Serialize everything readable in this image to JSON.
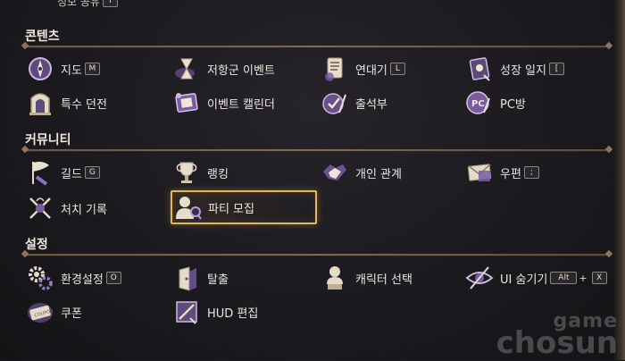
{
  "top_partial": {
    "label": "정보 공유",
    "key": "I"
  },
  "sections": {
    "content": {
      "title": "콘텐츠",
      "items": [
        {
          "icon": "compass-icon",
          "label": "지도",
          "key": "M"
        },
        {
          "icon": "hourglass-icon",
          "label": "저항군 이벤트"
        },
        {
          "icon": "scroll-icon",
          "label": "연대기",
          "key": "L"
        },
        {
          "icon": "journal-icon",
          "label": "성장 일지",
          "key": "["
        },
        {
          "icon": "dungeon-gate-icon",
          "label": "특수 던전"
        },
        {
          "icon": "calendar-book-icon",
          "label": "이벤트 캘린더"
        },
        {
          "icon": "quill-check-icon",
          "label": "출석부"
        },
        {
          "icon": "pc-room-icon",
          "label": "PC방"
        }
      ]
    },
    "community": {
      "title": "커뮤니티",
      "items": [
        {
          "icon": "guild-flag-icon",
          "label": "길드",
          "key": "G"
        },
        {
          "icon": "trophy-icon",
          "label": "랭킹"
        },
        {
          "icon": "handshake-icon",
          "label": "개인 관계"
        },
        {
          "icon": "envelope-icon",
          "label": "우편",
          "key": ";"
        },
        {
          "icon": "crossed-swords-icon",
          "label": "처치 기록"
        },
        {
          "icon": "party-search-icon",
          "label": "파티 모집"
        }
      ]
    },
    "settings": {
      "title": "설정",
      "items": [
        {
          "icon": "gear-icon",
          "label": "환경설정",
          "key": "O"
        },
        {
          "icon": "exit-door-icon",
          "label": "탈출"
        },
        {
          "icon": "character-bust-icon",
          "label": "캐릭터 선택"
        },
        {
          "icon": "eye-hidden-icon",
          "label": "UI 숨기기",
          "key": "Alt",
          "key2": "X"
        },
        {
          "icon": "coupon-icon",
          "label": "쿠폰"
        },
        {
          "icon": "hud-edit-icon",
          "label": "HUD 편집"
        }
      ]
    }
  },
  "watermark": {
    "line1": "game",
    "line2": "chosun"
  },
  "colors": {
    "accent_gold": "#e6b75a",
    "icon_purple": "#9a7bbd",
    "divider": "#7d6b52"
  }
}
